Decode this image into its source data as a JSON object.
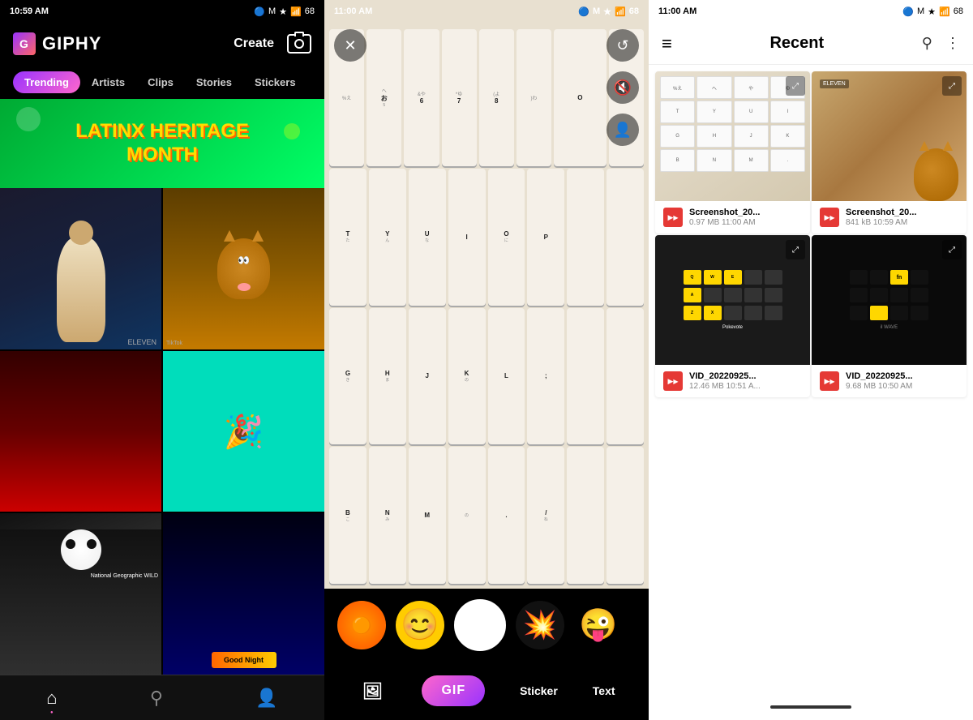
{
  "panel_giphy": {
    "status": {
      "time": "10:59 AM",
      "icons": "⊠ M ★"
    },
    "logo": "GIPHY",
    "header": {
      "create_label": "Create",
      "camera_label": "📷"
    },
    "nav": {
      "items": [
        "Trending",
        "Artists",
        "Clips",
        "Stories",
        "Stickers"
      ]
    },
    "banner": {
      "line1": "LATINX HERITAGE",
      "line2": "MONTH"
    },
    "bottom_nav": {
      "items": [
        {
          "label": "Home",
          "icon": "⌂",
          "active": true
        },
        {
          "label": "Search",
          "icon": "⚲"
        },
        {
          "label": "Profile",
          "icon": "👤"
        }
      ]
    }
  },
  "panel_camera": {
    "status": {
      "time": "11:00 AM",
      "icons": "⊠ M ★"
    },
    "buttons": {
      "close": "✕",
      "flip": "🔄",
      "mute": "🔇",
      "face": "👤"
    },
    "stickers": [
      "🟠",
      "😊",
      "",
      "💥",
      "😜"
    ],
    "bottom_bar": {
      "gallery_label": "🖼",
      "gif_label": "GIF",
      "sticker_label": "Sticker",
      "text_label": "Text"
    }
  },
  "panel_files": {
    "status": {
      "time": "11:00 AM",
      "icons": "⊠ M ★"
    },
    "header": {
      "title": "Recent",
      "menu_icon": "≡",
      "search_icon": "⚲",
      "more_icon": "⋮"
    },
    "files": [
      {
        "name": "Screenshot_20...",
        "size": "0.97 MB",
        "time": "11:00 AM",
        "type": "image"
      },
      {
        "name": "Screenshot_20...",
        "size": "841 kB",
        "time": "10:59 AM",
        "type": "image"
      },
      {
        "name": "VID_20220925...",
        "size": "12.46 MB",
        "time": "10:51 A...",
        "type": "video"
      },
      {
        "name": "VID_20220925...",
        "size": "9.68 MB",
        "time": "10:50 AM",
        "type": "video"
      }
    ]
  }
}
